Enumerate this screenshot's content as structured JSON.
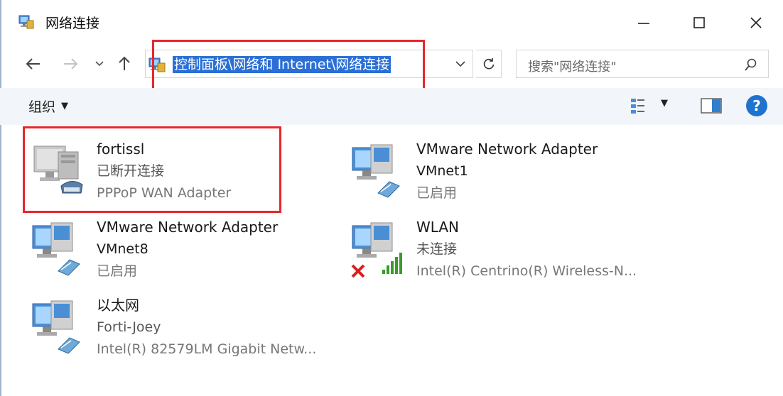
{
  "window": {
    "title": "网络连接"
  },
  "address": {
    "path": "控制面板\\网络和 Internet\\网络连接"
  },
  "search": {
    "placeholder": "搜索\"网络连接\""
  },
  "toolbar": {
    "organize_label": "组织"
  },
  "connections": [
    {
      "name": "fortissl",
      "line2": "已断开连接",
      "line3": "PPPoP WAN Adapter",
      "icon": "dialup-connection-icon"
    },
    {
      "name": "VMware Network Adapter",
      "line2": "VMnet1",
      "line3": "已启用",
      "icon": "network-adapter-icon"
    },
    {
      "name": "VMware Network Adapter",
      "line2": "VMnet8",
      "line3": "已启用",
      "icon": "network-adapter-icon"
    },
    {
      "name": "WLAN",
      "line2": "未连接",
      "line3": "Intel(R) Centrino(R) Wireless-N...",
      "icon": "wireless-adapter-disconnected-icon"
    },
    {
      "name": "以太网",
      "line2": "Forti-Joey",
      "line3": "Intel(R) 82579LM Gigabit Netw...",
      "icon": "network-adapter-icon"
    }
  ],
  "colors": {
    "highlight": "#2b6fd6",
    "annotation_red": "#e8262a",
    "toolbar_bg": "#f2f6fb",
    "help_blue": "#1e73d0"
  }
}
